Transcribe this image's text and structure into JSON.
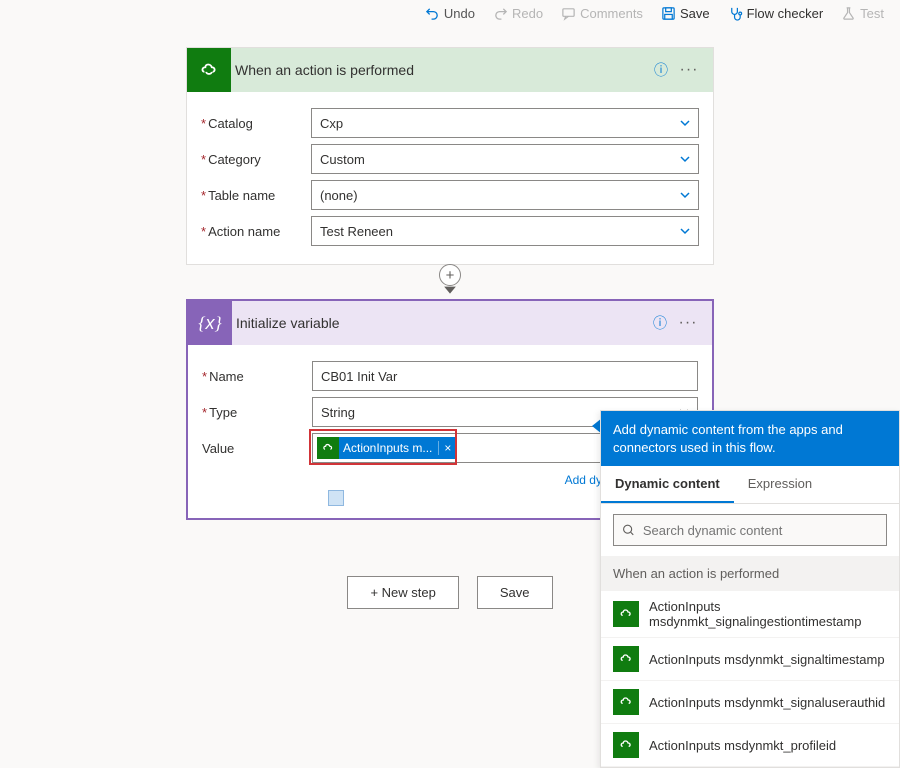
{
  "toolbar": {
    "undo": "Undo",
    "redo": "Redo",
    "comments": "Comments",
    "save": "Save",
    "flow_checker": "Flow checker",
    "test": "Test"
  },
  "trigger": {
    "title": "When an action is performed",
    "fields": {
      "catalog_label": "Catalog",
      "catalog_value": "Cxp",
      "category_label": "Category",
      "category_value": "Custom",
      "table_label": "Table name",
      "table_value": "(none)",
      "action_label": "Action name",
      "action_value": "Test Reneen"
    }
  },
  "variable": {
    "title": "Initialize variable",
    "fields": {
      "name_label": "Name",
      "name_value": "CB01 Init Var",
      "type_label": "Type",
      "type_value": "String",
      "value_label": "Value"
    },
    "token": {
      "label": "ActionInputs m...",
      "close": "×"
    },
    "dyn_link": "Add dynamic content"
  },
  "buttons": {
    "new_step": "+ New step",
    "save": "Save"
  },
  "dyn_panel": {
    "banner": "Add dynamic content from the apps and connectors used in this flow.",
    "tab_dynamic": "Dynamic content",
    "tab_expression": "Expression",
    "search_placeholder": "Search dynamic content",
    "group": "When an action is performed",
    "items": [
      "ActionInputs msdynmkt_signalingestiontimestamp",
      "ActionInputs msdynmkt_signaltimestamp",
      "ActionInputs msdynmkt_signaluserauthid",
      "ActionInputs msdynmkt_profileid"
    ]
  }
}
